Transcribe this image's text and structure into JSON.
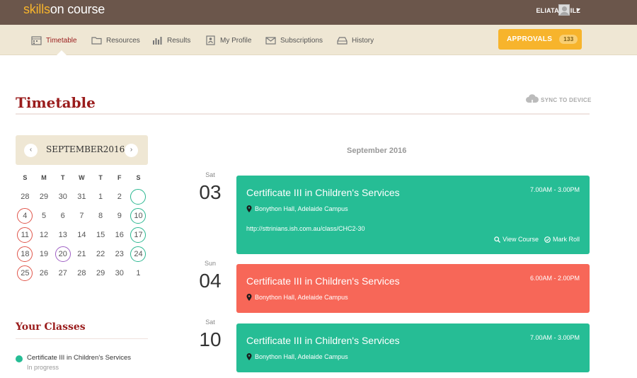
{
  "app": {
    "logo_part1": "skills",
    "logo_part2": "on course",
    "user_name": "ELIATAN HILL"
  },
  "nav": {
    "items": [
      {
        "label": "Timetable",
        "icon": "calendar-icon",
        "active": true
      },
      {
        "label": "Resources",
        "icon": "folder-icon",
        "active": false
      },
      {
        "label": "Results",
        "icon": "bar-chart-icon",
        "active": false
      },
      {
        "label": "My Profile",
        "icon": "profile-card-icon",
        "active": false
      },
      {
        "label": "Subscriptions",
        "icon": "envelope-icon",
        "active": false
      },
      {
        "label": "History",
        "icon": "inbox-tray-icon",
        "active": false
      }
    ],
    "approvals_label": "APPROVALS",
    "approvals_count": "133"
  },
  "page": {
    "title": "Timetable",
    "sync_label": "SYNC TO DEVICE"
  },
  "calendar": {
    "month_label": "SEPTEMBER2016",
    "prev": "‹",
    "next": "›",
    "weekdays": [
      "S",
      "M",
      "T",
      "W",
      "T",
      "F",
      "S"
    ],
    "weeks": [
      [
        {
          "d": "28",
          "m": ""
        },
        {
          "d": "29",
          "m": ""
        },
        {
          "d": "30",
          "m": ""
        },
        {
          "d": "31",
          "m": ""
        },
        {
          "d": "1",
          "m": ""
        },
        {
          "d": "2",
          "m": ""
        },
        {
          "d": "",
          "m": "green"
        }
      ],
      [
        {
          "d": "4",
          "m": "red"
        },
        {
          "d": "5",
          "m": ""
        },
        {
          "d": "6",
          "m": ""
        },
        {
          "d": "7",
          "m": ""
        },
        {
          "d": "8",
          "m": ""
        },
        {
          "d": "9",
          "m": ""
        },
        {
          "d": "10",
          "m": "green"
        }
      ],
      [
        {
          "d": "11",
          "m": "red"
        },
        {
          "d": "12",
          "m": ""
        },
        {
          "d": "13",
          "m": ""
        },
        {
          "d": "14",
          "m": ""
        },
        {
          "d": "15",
          "m": ""
        },
        {
          "d": "16",
          "m": ""
        },
        {
          "d": "17",
          "m": "green"
        }
      ],
      [
        {
          "d": "18",
          "m": "red"
        },
        {
          "d": "19",
          "m": ""
        },
        {
          "d": "20",
          "m": "purple"
        },
        {
          "d": "21",
          "m": ""
        },
        {
          "d": "22",
          "m": ""
        },
        {
          "d": "23",
          "m": ""
        },
        {
          "d": "24",
          "m": "green"
        }
      ],
      [
        {
          "d": "25",
          "m": "red"
        },
        {
          "d": "26",
          "m": ""
        },
        {
          "d": "27",
          "m": ""
        },
        {
          "d": "28",
          "m": ""
        },
        {
          "d": "29",
          "m": ""
        },
        {
          "d": "30",
          "m": ""
        },
        {
          "d": "1",
          "m": ""
        }
      ]
    ]
  },
  "classes": {
    "title": "Your Classes",
    "items": [
      {
        "name": "Certificate III in Children's Services",
        "status": "In progress"
      }
    ]
  },
  "events": {
    "month_label": "September 2016",
    "list": [
      {
        "dow": "Sat",
        "day": "03",
        "color": "green",
        "title": "Certificate III in Children's Services",
        "time": "7.00AM - 3.00PM",
        "location": "Bonython Hall, Adelaide Campus",
        "url": "http://sttrinians.ish.com.au/class/CHC2-30",
        "view_label": "View Course",
        "roll_label": "Mark Roll"
      },
      {
        "dow": "Sun",
        "day": "04",
        "color": "red",
        "title": "Certificate III in Children's Services",
        "time": "6.00AM - 2.00PM",
        "location": "Bonython Hall, Adelaide Campus"
      },
      {
        "dow": "Sat",
        "day": "10",
        "color": "green",
        "title": "Certificate III in Children's Services",
        "time": "7.00AM - 3.00PM",
        "location": "Bonython Hall, Adelaide Campus"
      }
    ]
  },
  "colors": {
    "topbar": "#6b564b",
    "navbar": "#efe7d4",
    "accent_orange": "#f7b42c",
    "title_red": "#9a1c1c",
    "event_green": "#26bd95",
    "event_red": "#f76758",
    "marker_purple": "#9e5fc4"
  }
}
